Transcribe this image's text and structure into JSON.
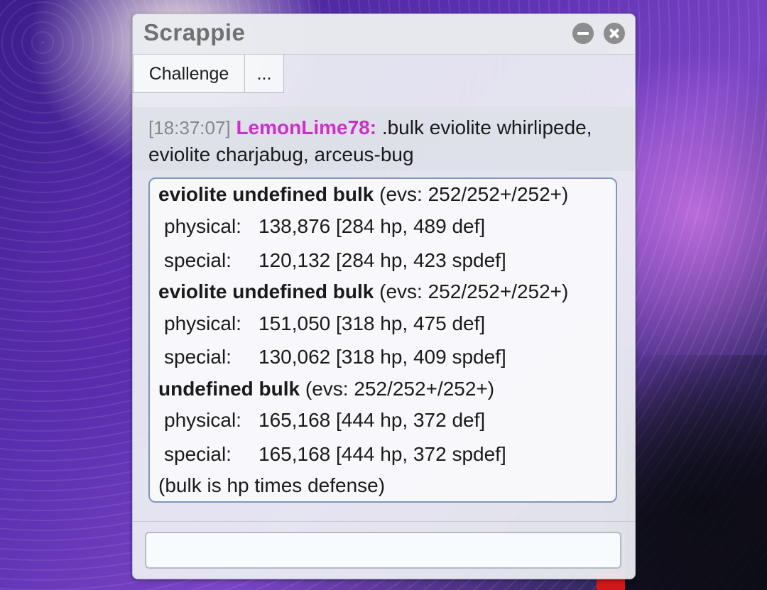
{
  "window": {
    "title": "Scrappie"
  },
  "tabs": [
    {
      "label": "Challenge"
    },
    {
      "label": "..."
    }
  ],
  "message": {
    "timestamp": "[18:37:07]",
    "username": "LemonLime78:",
    "text": " .bulk eviolite whirlipede, eviolite charjabug, arceus-bug"
  },
  "results": [
    {
      "header_bold": "eviolite undefined bulk",
      "header_rest": " (evs: 252/252+/252+)",
      "physical_label": "physical:",
      "physical_value": "138,876 [284 hp, 489 def]",
      "special_label": "special:",
      "special_value": "120,132 [284 hp, 423 spdef]"
    },
    {
      "header_bold": "eviolite undefined bulk",
      "header_rest": " (evs: 252/252+/252+)",
      "physical_label": "physical:",
      "physical_value": "151,050 [318 hp, 475 def]",
      "special_label": "special:",
      "special_value": "130,062 [318 hp, 409 spdef]"
    },
    {
      "header_bold": "undefined bulk",
      "header_rest": " (evs: 252/252+/252+)",
      "physical_label": "physical:",
      "physical_value": "165,168 [444 hp, 372 def]",
      "special_label": "special:",
      "special_value": "165,168 [444 hp, 372 spdef]"
    }
  ],
  "footnote": "(bulk is hp times defense)",
  "input": {
    "value": "",
    "placeholder": ""
  },
  "icons": {
    "minimize": "minimize-icon",
    "close": "close-icon"
  },
  "colors": {
    "username": "#cc2fcc",
    "timestamp": "#888888",
    "title": "#707070",
    "box_border": "#7f97b8"
  }
}
